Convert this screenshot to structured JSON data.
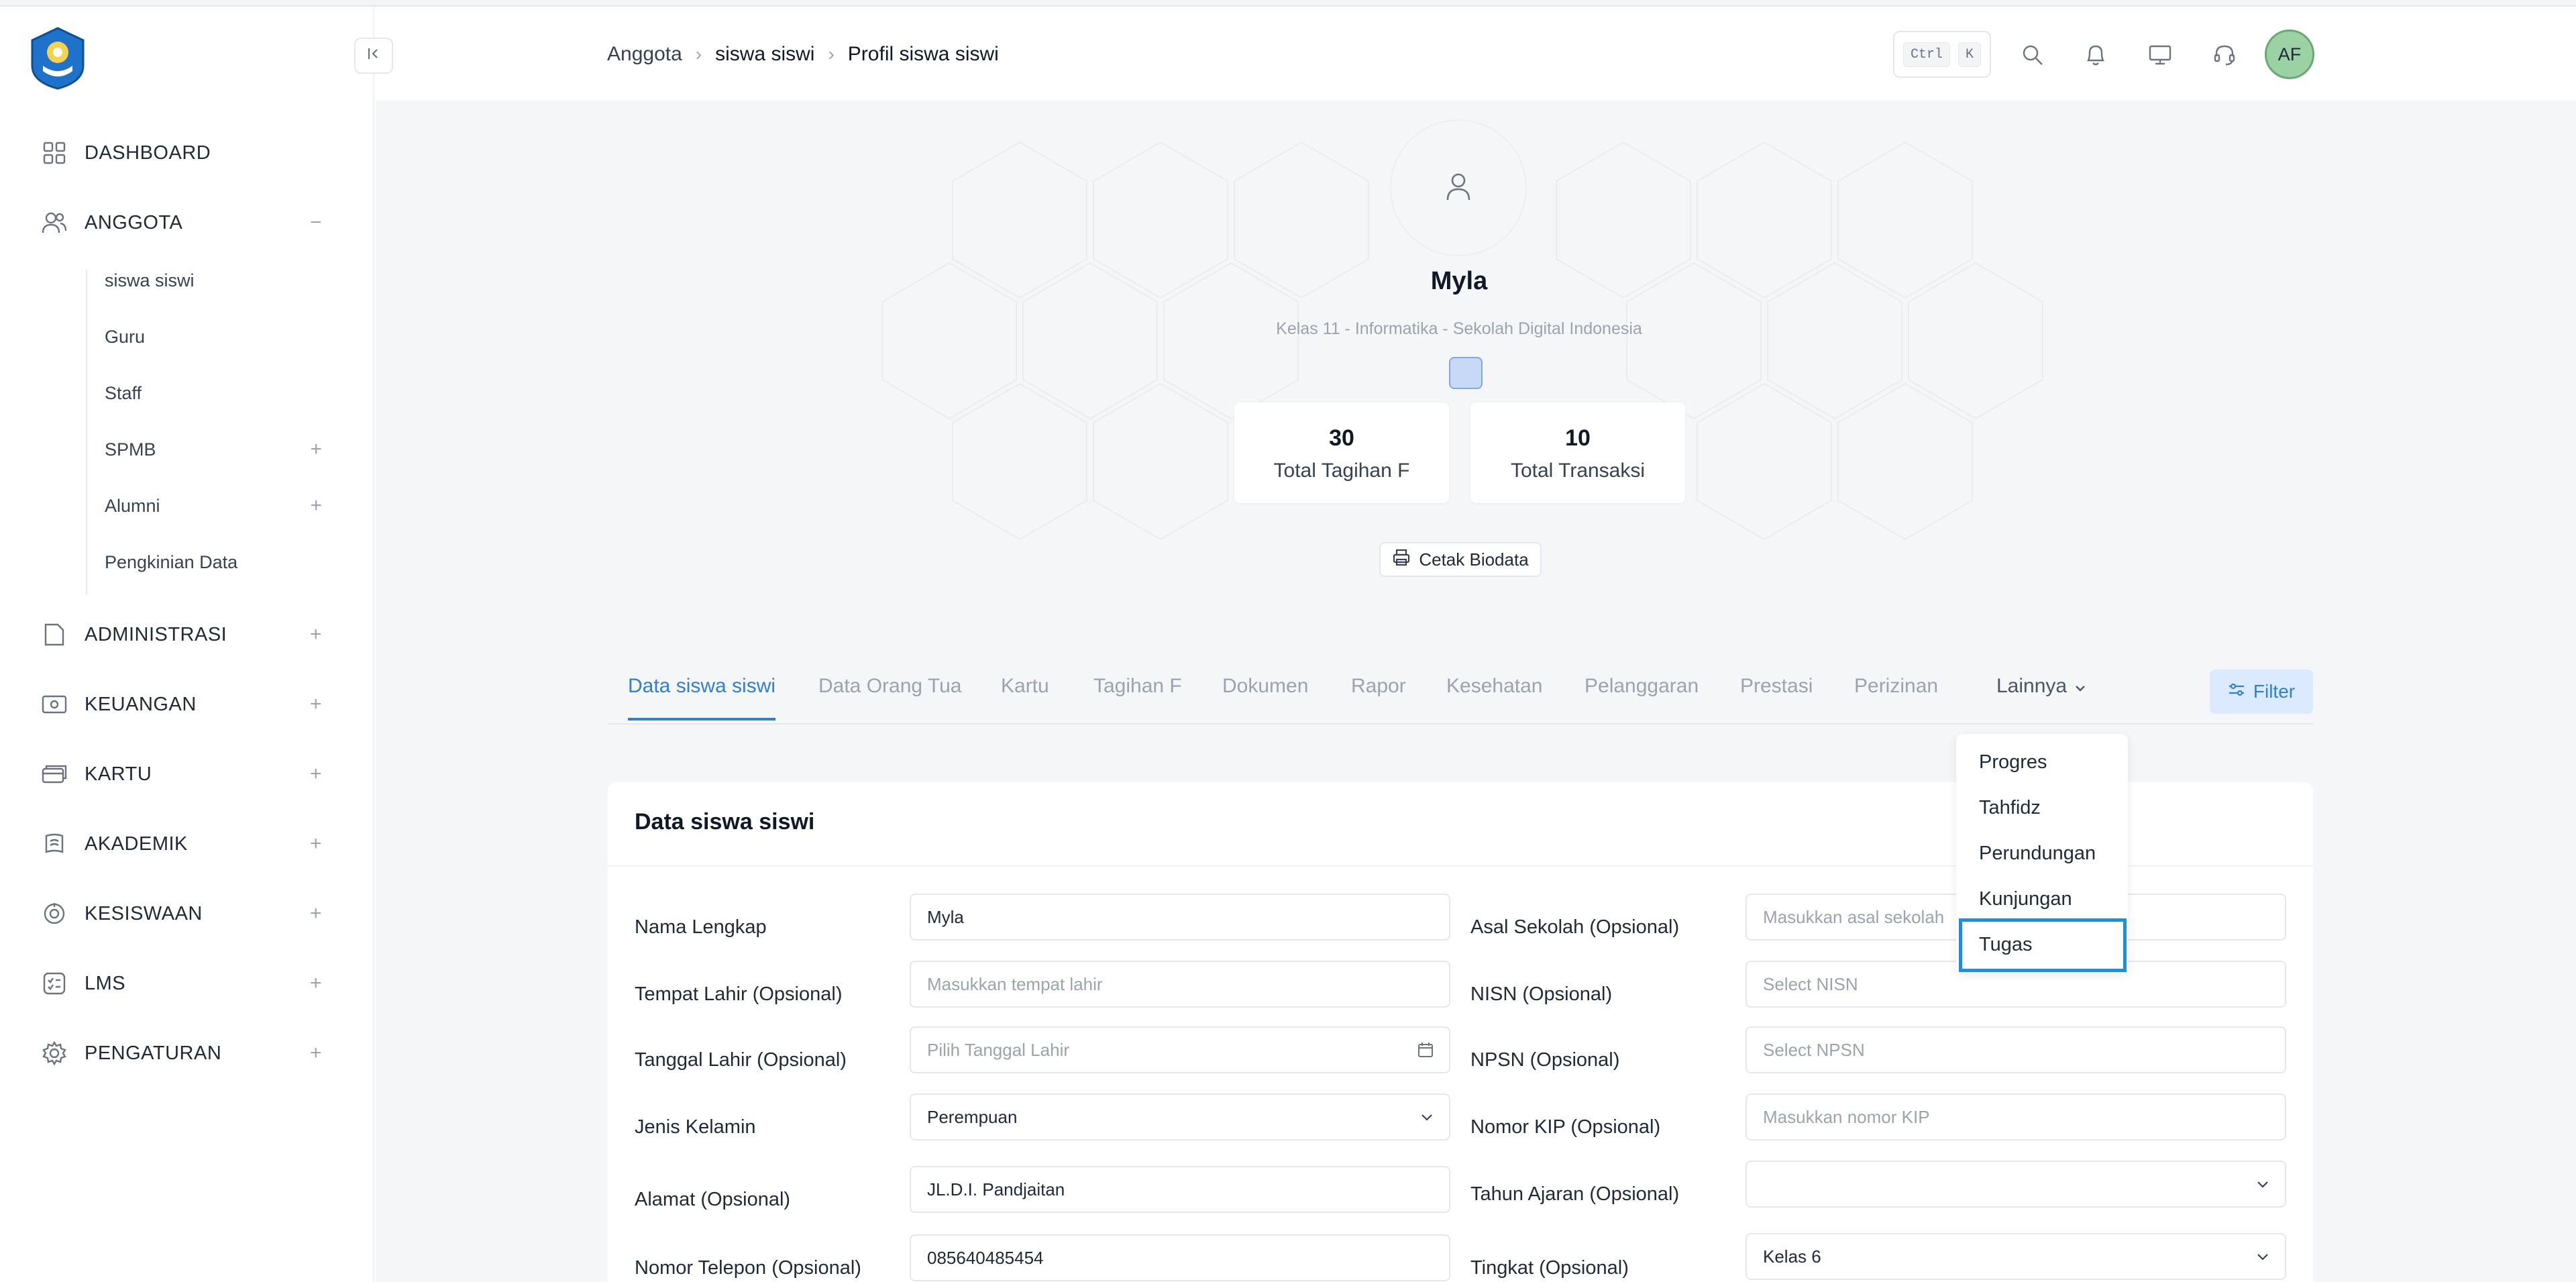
{
  "sidebar": {
    "items": [
      {
        "label": "DASHBOARD",
        "icon": "grid-icon",
        "toggle": ""
      },
      {
        "label": "ANGGOTA",
        "icon": "users-icon",
        "toggle": "−"
      },
      {
        "label": "ADMINISTRASI",
        "icon": "folder-icon",
        "toggle": "+"
      },
      {
        "label": "KEUANGAN",
        "icon": "money-icon",
        "toggle": "+"
      },
      {
        "label": "KARTU",
        "icon": "card-icon",
        "toggle": "+"
      },
      {
        "label": "AKADEMIK",
        "icon": "book-icon",
        "toggle": "+"
      },
      {
        "label": "KESISWAAN",
        "icon": "badge-icon",
        "toggle": "+"
      },
      {
        "label": "LMS",
        "icon": "checklist-icon",
        "toggle": "+"
      },
      {
        "label": "PENGATURAN",
        "icon": "gear-icon",
        "toggle": "+"
      }
    ],
    "sub_items": [
      {
        "label": "siswa siswi",
        "toggle": ""
      },
      {
        "label": "Guru",
        "toggle": ""
      },
      {
        "label": "Staff",
        "toggle": ""
      },
      {
        "label": "SPMB",
        "toggle": "+"
      },
      {
        "label": "Alumni",
        "toggle": "+"
      },
      {
        "label": "Pengkinian Data",
        "toggle": ""
      }
    ]
  },
  "header": {
    "breadcrumb": [
      "Anggota",
      "siswa siswi",
      "Profil siswa siswi"
    ],
    "shortcut_keys": [
      "Ctrl",
      "K"
    ],
    "avatar_initials": "AF"
  },
  "profile": {
    "name": "Myla",
    "subtitle": "Kelas 11 - Informatika - Sekolah Digital Indonesia",
    "stats": [
      {
        "value": "30",
        "label": "Total Tagihan F"
      },
      {
        "value": "10",
        "label": "Total Transaksi"
      }
    ],
    "print_button": "Cetak Biodata"
  },
  "tabs": {
    "items": [
      "Data siswa siswi",
      "Data Orang Tua",
      "Kartu",
      "Tagihan F",
      "Dokumen",
      "Rapor",
      "Kesehatan",
      "Pelanggaran",
      "Prestasi",
      "Perizinan"
    ],
    "active": "Data siswa siswi",
    "more_label": "Lainnya",
    "filter_label": "Filter"
  },
  "dropdown": {
    "items": [
      "Progres",
      "Tahfidz",
      "Perundungan",
      "Kunjungan",
      "Tugas"
    ],
    "highlighted": "Tugas"
  },
  "form": {
    "title": "Data siswa siswi",
    "left": [
      {
        "label": "Nama Lengkap",
        "value": "Myla",
        "placeholder": ""
      },
      {
        "label": "Tempat Lahir (Opsional)",
        "value": "",
        "placeholder": "Masukkan tempat lahir"
      },
      {
        "label": "Tanggal Lahir (Opsional)",
        "value": "",
        "placeholder": "Pilih Tanggal Lahir"
      },
      {
        "label": "Jenis Kelamin",
        "value": "Perempuan",
        "placeholder": ""
      },
      {
        "label": "Alamat (Opsional)",
        "value": "JL.D.I. Pandjaitan",
        "placeholder": ""
      },
      {
        "label": "Nomor Telepon (Opsional)",
        "value": "085640485454",
        "placeholder": ""
      }
    ],
    "right": [
      {
        "label": "Asal Sekolah (Opsional)",
        "value": "",
        "placeholder": "Masukkan asal sekolah"
      },
      {
        "label": "NISN (Opsional)",
        "value": "",
        "placeholder": "Select NISN"
      },
      {
        "label": "NPSN (Opsional)",
        "value": "",
        "placeholder": "Select NPSN"
      },
      {
        "label": "Nomor KIP (Opsional)",
        "value": "",
        "placeholder": "Masukkan nomor KIP"
      },
      {
        "label": "Tahun Ajaran (Opsional)",
        "value": "",
        "placeholder": ""
      },
      {
        "label": "Tingkat (Opsional)",
        "value": "Kelas 6",
        "placeholder": ""
      }
    ]
  },
  "colors": {
    "accent": "#2f7fd4",
    "highlight_border": "#1d8fdc",
    "main_bg": "#f5f6f7",
    "avatar_bg": "#9bd1a3"
  }
}
